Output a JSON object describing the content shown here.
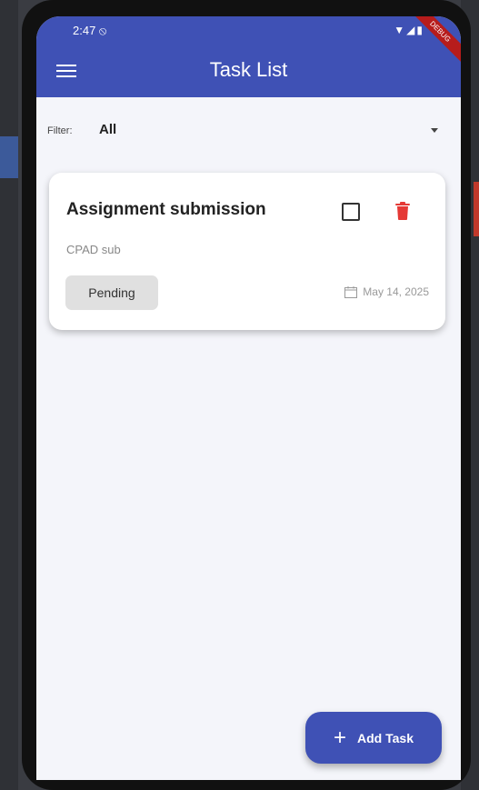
{
  "status_bar": {
    "time": "2:47 ⦸",
    "icons": "▼◢▮",
    "ribbon": "DEBUG"
  },
  "app_bar": {
    "title": "Task List",
    "menu_icon": "menu-icon"
  },
  "filter": {
    "label": "Filter:",
    "value": "All"
  },
  "tasks": [
    {
      "title": "Assignment submission",
      "description": "CPAD sub",
      "status": "Pending",
      "due_date": "May 14, 2025",
      "completed": false
    }
  ],
  "fab": {
    "label": "Add Task",
    "icon": "+"
  },
  "colors": {
    "primary": "#3f51b5",
    "delete": "#e53935",
    "background": "#f4f5fa"
  }
}
